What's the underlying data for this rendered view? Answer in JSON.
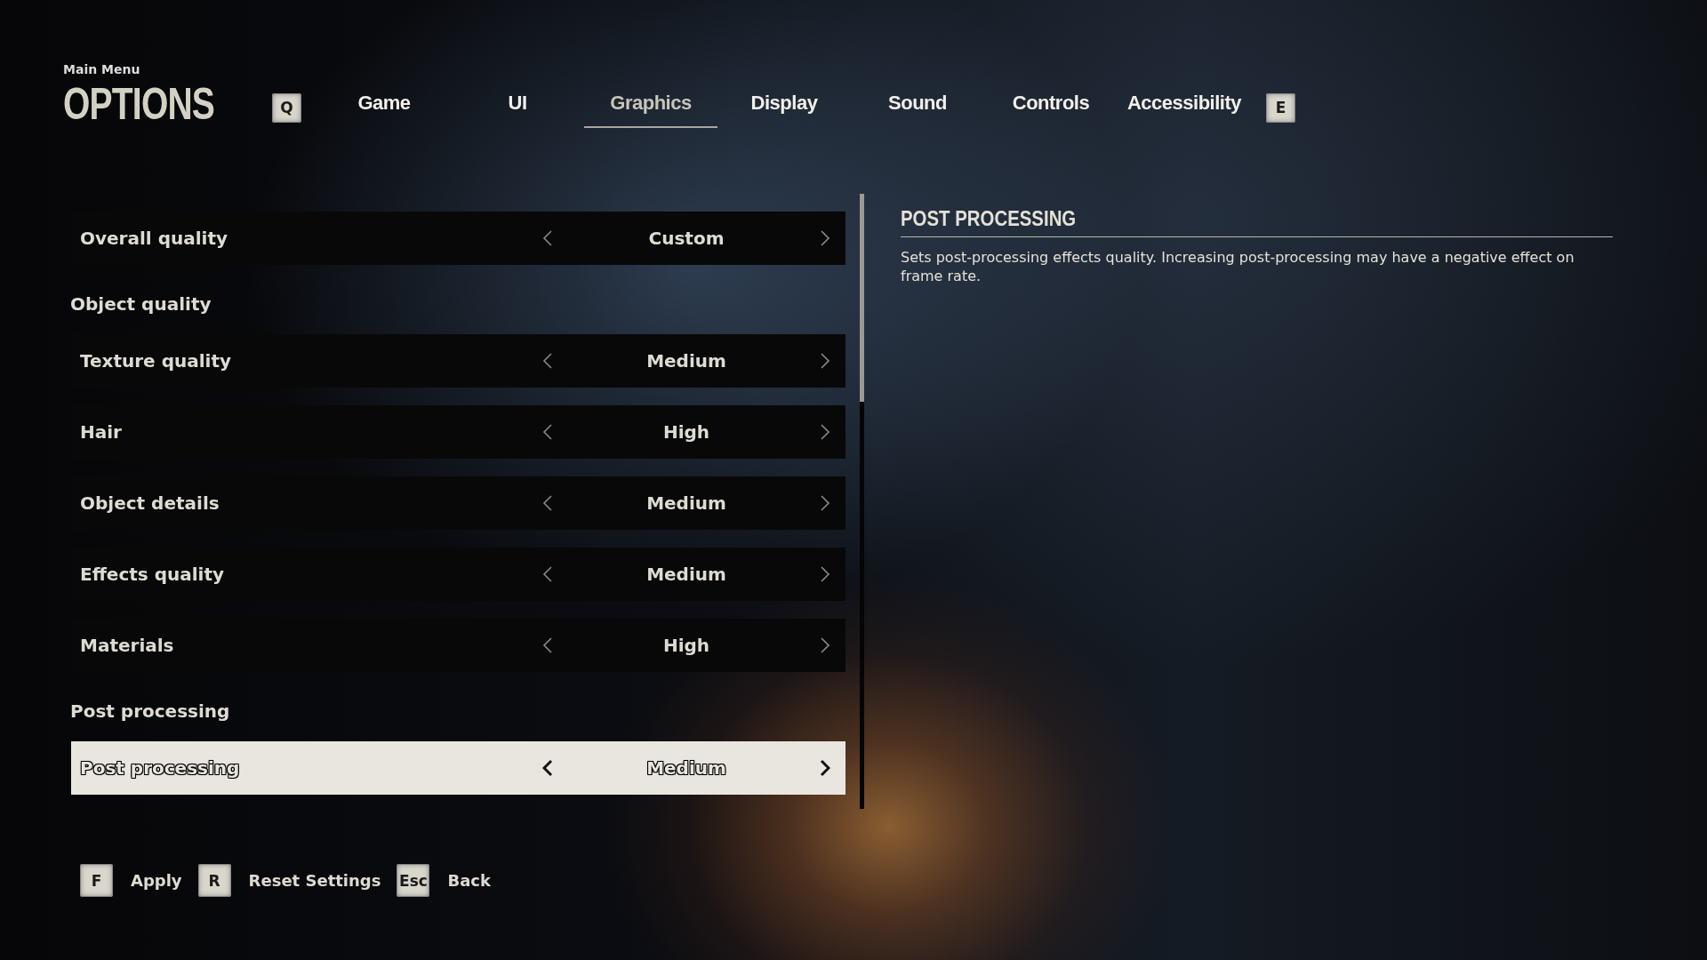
{
  "breadcrumb": "Main Menu",
  "title": "OPTIONS",
  "tab_keys": {
    "prev": "Q",
    "next": "E"
  },
  "tabs": [
    {
      "label": "Game",
      "selected": false
    },
    {
      "label": "UI",
      "selected": false
    },
    {
      "label": "Graphics",
      "selected": true
    },
    {
      "label": "Display",
      "selected": false
    },
    {
      "label": "Sound",
      "selected": false
    },
    {
      "label": "Controls",
      "selected": false
    },
    {
      "label": "Accessibility",
      "selected": false
    }
  ],
  "settings": [
    {
      "kind": "option",
      "label": "Overall quality",
      "value": "Custom",
      "selected": false
    },
    {
      "kind": "header",
      "label": "Object quality"
    },
    {
      "kind": "option",
      "label": "Texture quality",
      "value": "Medium",
      "selected": false
    },
    {
      "kind": "option",
      "label": "Hair",
      "value": "High",
      "selected": false
    },
    {
      "kind": "option",
      "label": "Object details",
      "value": "Medium",
      "selected": false
    },
    {
      "kind": "option",
      "label": "Effects quality",
      "value": "Medium",
      "selected": false
    },
    {
      "kind": "option",
      "label": "Materials",
      "value": "High",
      "selected": false
    },
    {
      "kind": "header",
      "label": "Post processing"
    },
    {
      "kind": "option",
      "label": "Post processing",
      "value": "Medium",
      "selected": true
    }
  ],
  "description": {
    "title": "POST PROCESSING",
    "text": "Sets post-processing effects quality. Increasing post-processing may have a negative effect on frame rate."
  },
  "actions": [
    {
      "key": "F",
      "label": "Apply"
    },
    {
      "key": "R",
      "label": "Reset Settings"
    },
    {
      "key": "Esc",
      "label": "Back"
    }
  ]
}
